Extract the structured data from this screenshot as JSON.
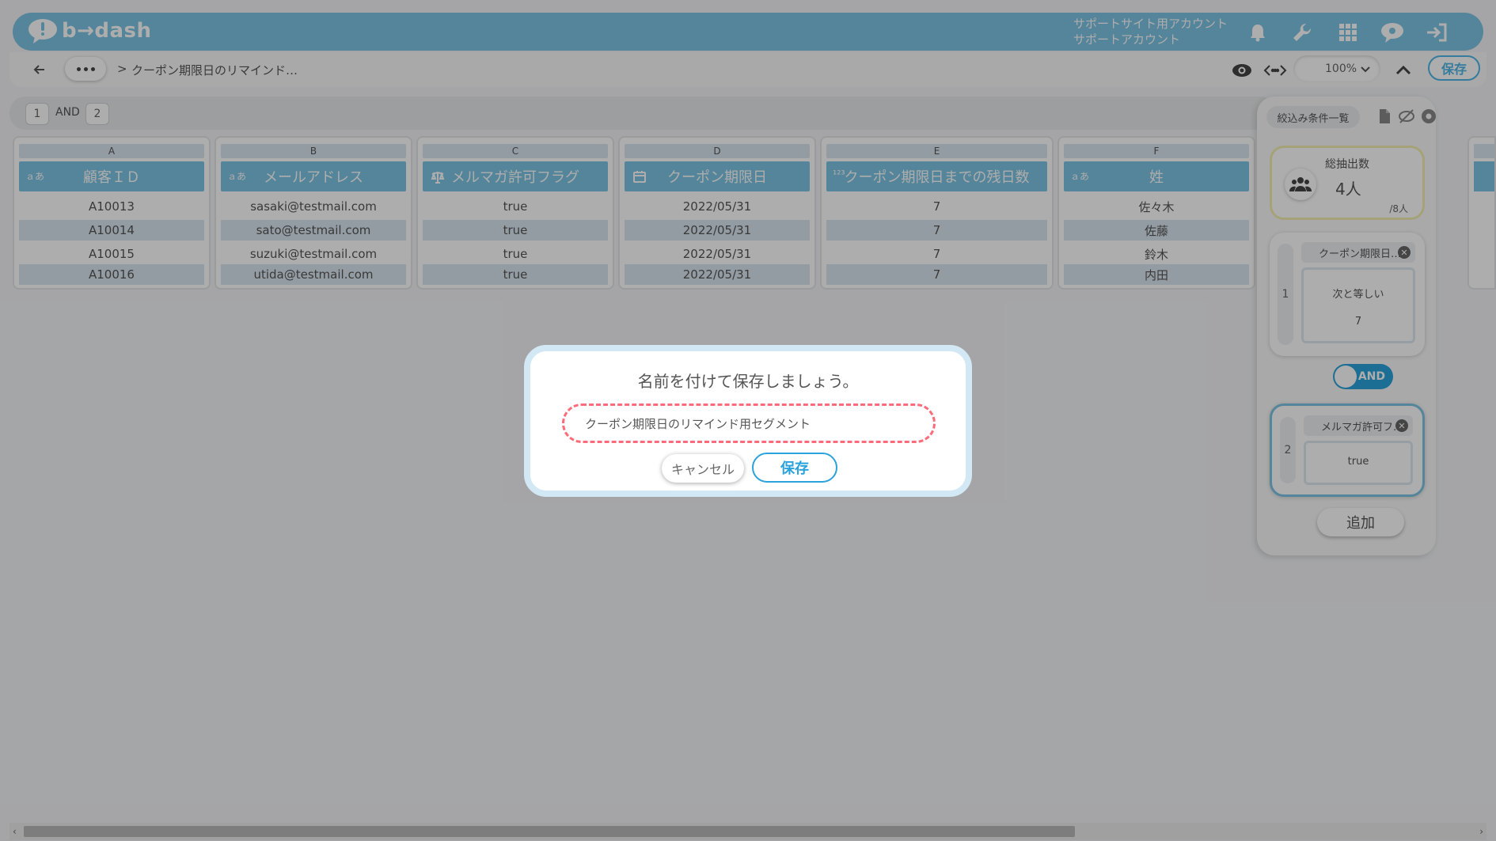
{
  "header": {
    "logo_text": "b→dash",
    "account_line1": "サポートサイト用アカウント",
    "account_line2": "サポートアカウント",
    "icons": [
      "bell-icon",
      "wrench-icon",
      "apps-grid-icon",
      "chat-bubble-icon",
      "logout-icon"
    ],
    "accent_color": "#7ec5e3"
  },
  "toolbar": {
    "breadcrumb_sep": ">",
    "breadcrumb_title": "クーポン期限日のリマインド…",
    "zoom": "100%",
    "save_label": "保存"
  },
  "conditions_bar": {
    "chip1": "1",
    "operator": "AND",
    "chip2": "2"
  },
  "table": {
    "columns": [
      {
        "letter": "A",
        "header": "顧客ＩＤ",
        "type_icon": "text-type-icon",
        "cells": [
          "A10013",
          "A10014",
          "A10015",
          "A10016"
        ]
      },
      {
        "letter": "B",
        "header": "メールアドレス",
        "type_icon": "text-type-icon",
        "cells": [
          "sasaki@testmail.com",
          "sato@testmail.com",
          "suzuki@testmail.com",
          "utida@testmail.com"
        ]
      },
      {
        "letter": "C",
        "header": "メルマガ許可フラグ",
        "type_icon": "boolean-type-icon",
        "cells": [
          "true",
          "true",
          "true",
          "true"
        ]
      },
      {
        "letter": "D",
        "header": "クーポン期限日",
        "type_icon": "calendar-icon",
        "cells": [
          "2022/05/31",
          "2022/05/31",
          "2022/05/31",
          "2022/05/31"
        ]
      },
      {
        "letter": "E",
        "header": "クーポン期限日までの残日数",
        "type_icon": "number-type-icon",
        "cells": [
          "7",
          "7",
          "7",
          "7"
        ]
      },
      {
        "letter": "F",
        "header": "姓",
        "type_icon": "text-type-icon",
        "cells": [
          "佐々木",
          "佐藤",
          "鈴木",
          "内田"
        ]
      }
    ]
  },
  "right_panel": {
    "filter_list_label": "絞込み条件一覧",
    "count_label": "総抽出数",
    "count_value": "4人",
    "count_total": "/8人",
    "conditions": [
      {
        "num": "1",
        "title": "クーポン期限日…",
        "operator": "次と等しい",
        "value": "7"
      },
      {
        "num": "2",
        "title": "メルマガ許可フ…",
        "value": "true"
      }
    ],
    "and_toggle": "AND",
    "add_label": "追加"
  },
  "modal": {
    "title": "名前を付けて保存しましょう。",
    "input_value": "クーポン期限日のリマインド用セグメント",
    "cancel_label": "キャンセル",
    "save_label": "保存",
    "highlight_color": "#ff6b7a"
  }
}
